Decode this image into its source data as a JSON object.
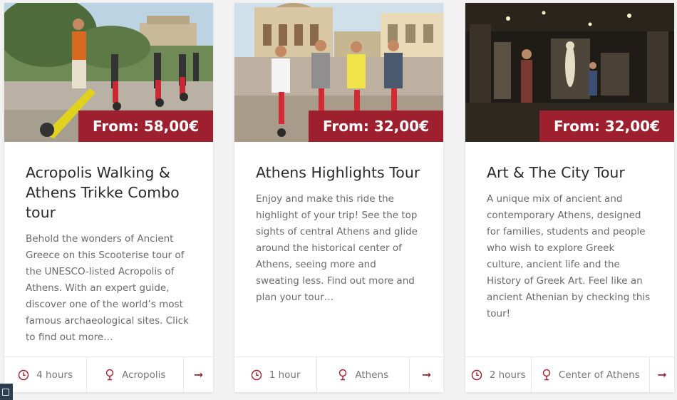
{
  "theme": {
    "accent": "#9e1f2d",
    "card_bg": "#ffffff",
    "page_bg": "#f2f2f2"
  },
  "icons": {
    "duration": "clock-icon",
    "location": "location-pin-icon",
    "more": "arrow-right-icon"
  },
  "tours": [
    {
      "title": "Acropolis Walking & Athens Trikke Combo tour",
      "price": "From: 58,00€",
      "description": "Behold the wonders of Ancient Greece on this Scooterise tour of the UNESCO-listed Acropolis of Athens. With an expert guide, discover one of the world’s most famous archaeological sites. Click to find out more…",
      "duration": "4 hours",
      "location": "Acropolis",
      "arrow": "➞"
    },
    {
      "title": "Athens Highlights Tour",
      "price": "From: 32,00€",
      "description": "Enjoy and make this ride the highlight of your trip! See the top sights of central Athens and glide around the historical center of Athens, seeing more and sweating less. Find out more and plan your tour…",
      "duration": "1 hour",
      "location": "Athens",
      "arrow": "➞"
    },
    {
      "title": "Art & The City Tour",
      "price": "From: 32,00€",
      "description": "A unique mix of ancient and contemporary Athens, designed for families, students and people who wish to explore Greek culture, ancient life and the History of Greek Art. Feel like an ancient Athenian by checking this tour!",
      "duration": "2 hours",
      "location": "Center of Athens",
      "arrow": "➞"
    }
  ]
}
